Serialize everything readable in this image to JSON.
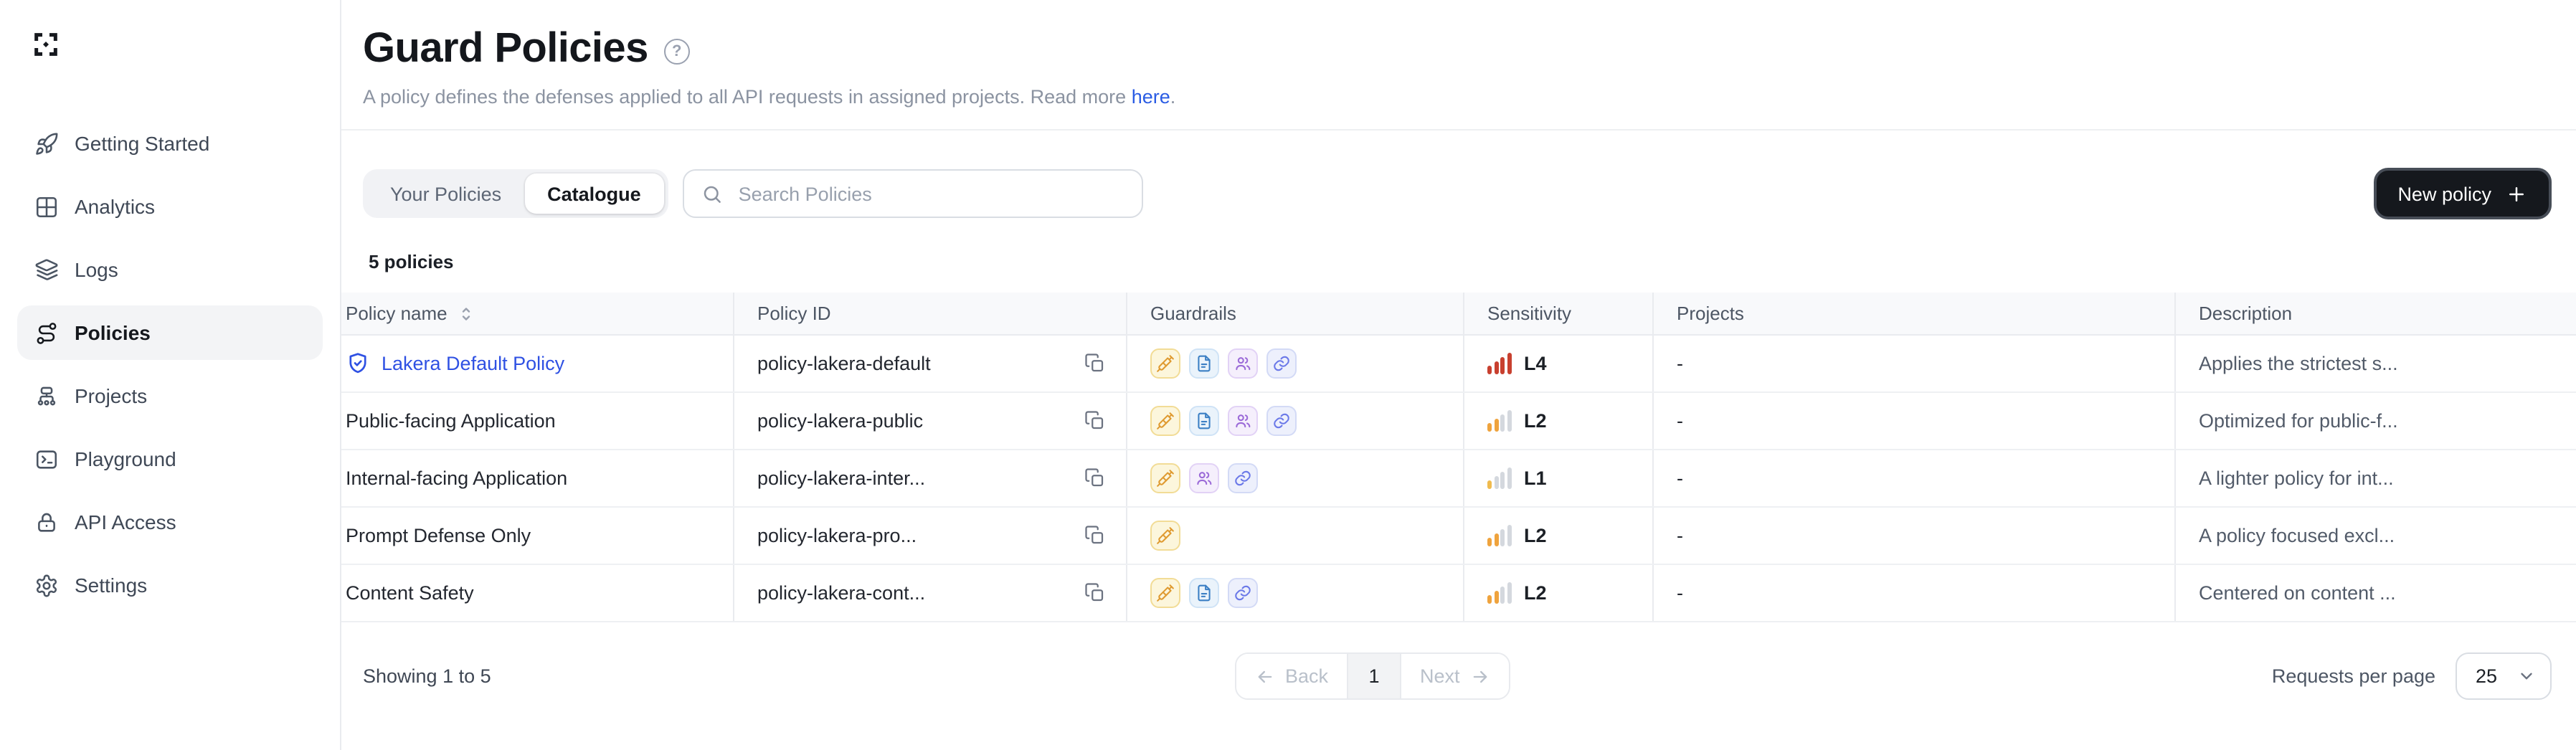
{
  "sidebar": {
    "items": [
      {
        "label": "Getting Started",
        "icon": "rocket-icon"
      },
      {
        "label": "Analytics",
        "icon": "grid-icon"
      },
      {
        "label": "Logs",
        "icon": "layers-icon"
      },
      {
        "label": "Policies",
        "icon": "route-icon",
        "active": true
      },
      {
        "label": "Projects",
        "icon": "org-tree-icon"
      },
      {
        "label": "Playground",
        "icon": "terminal-icon"
      },
      {
        "label": "API Access",
        "icon": "lock-icon"
      },
      {
        "label": "Settings",
        "icon": "gear-icon"
      }
    ]
  },
  "header": {
    "title": "Guard Policies",
    "description": "A policy defines the defenses applied to all API requests in assigned projects. Read more",
    "link_text": "here",
    "period": "."
  },
  "toolbar": {
    "tabs": [
      {
        "label": "Your Policies",
        "active": false
      },
      {
        "label": "Catalogue",
        "active": true
      }
    ],
    "search_placeholder": "Search Policies",
    "new_policy_label": "New policy"
  },
  "summary": {
    "policies_count": "5 policies"
  },
  "table": {
    "columns": [
      "Policy name",
      "Policy ID",
      "Guardrails",
      "Sensitivity",
      "Projects",
      "Description"
    ],
    "rows": [
      {
        "name": "Lakera Default Policy",
        "is_default": true,
        "id": "policy-lakera-default",
        "guardrails": [
          "prompt",
          "content",
          "pii",
          "link"
        ],
        "sensitivity": {
          "label": "L4",
          "bars": 4,
          "color": "#c8402f"
        },
        "projects": "-",
        "description": "Applies the strictest s..."
      },
      {
        "name": "Public-facing Application",
        "is_default": false,
        "id": "policy-lakera-public",
        "guardrails": [
          "prompt",
          "content",
          "pii",
          "link"
        ],
        "sensitivity": {
          "label": "L2",
          "bars": 2,
          "color": "#efa33d"
        },
        "projects": "-",
        "description": "Optimized for public-f..."
      },
      {
        "name": "Internal-facing Application",
        "is_default": false,
        "id": "policy-lakera-inter...",
        "guardrails": [
          "prompt",
          "pii",
          "link"
        ],
        "sensitivity": {
          "label": "L1",
          "bars": 1,
          "color": "#f0bb4e"
        },
        "projects": "-",
        "description": "A lighter policy for int..."
      },
      {
        "name": "Prompt Defense Only",
        "is_default": false,
        "id": "policy-lakera-pro...",
        "guardrails": [
          "prompt"
        ],
        "sensitivity": {
          "label": "L2",
          "bars": 2,
          "color": "#efa33d"
        },
        "projects": "-",
        "description": "A policy focused excl..."
      },
      {
        "name": "Content Safety",
        "is_default": false,
        "id": "policy-lakera-cont...",
        "guardrails": [
          "prompt",
          "content",
          "link"
        ],
        "sensitivity": {
          "label": "L2",
          "bars": 2,
          "color": "#efa33d"
        },
        "projects": "-",
        "description": "Centered on content ..."
      }
    ],
    "bar_empty_color": "#d4d8de",
    "bar_heights": [
      6,
      9,
      12,
      15
    ]
  },
  "footer": {
    "showing": "Showing 1 to 5",
    "back_label": "Back",
    "current_page": "1",
    "next_label": "Next",
    "per_page_label": "Requests per page",
    "per_page_value": "25"
  },
  "colors": {
    "accent_blue": "#2f51e3",
    "link_blue": "#2a5ce4",
    "sensitivity_high": "#c8402f",
    "sensitivity_mid": "#efa33d"
  }
}
